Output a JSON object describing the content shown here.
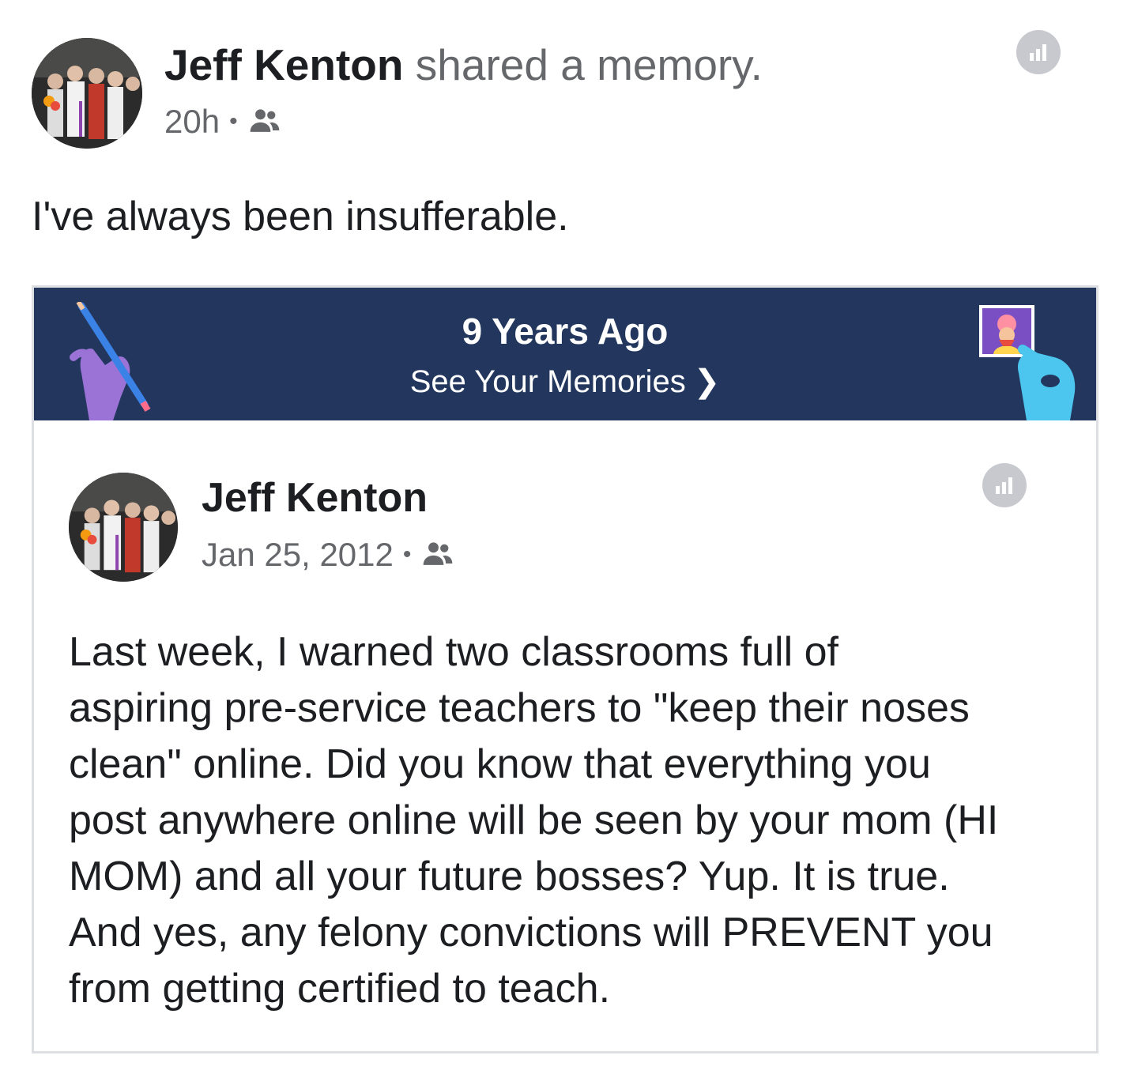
{
  "post": {
    "author": "Jeff Kenton",
    "action": "shared a memory.",
    "time": "20h",
    "separator": "•",
    "audience_icon": "friends-icon",
    "caption": "I've always been insufferable."
  },
  "memory": {
    "banner_title": "9 Years Ago",
    "banner_link": "See Your Memories",
    "banner_chevron": "❯",
    "colors": {
      "banner_bg": "#23375e",
      "left_hand": "#9b72d6",
      "right_hand": "#4cc6ee"
    },
    "original_post": {
      "author": "Jeff Kenton",
      "date": "Jan 25, 2012",
      "separator": "•",
      "audience_icon": "friends-icon",
      "body": "Last week, I warned two classrooms full of\naspiring pre-service teachers to \"keep their noses\nclean\" online. Did you know that everything you\npost anywhere online will be seen by your mom (HI\nMOM) and all your future bosses? Yup. It is true.\nAnd yes, any felony convictions will PREVENT you\nfrom getting certified to teach."
    }
  }
}
